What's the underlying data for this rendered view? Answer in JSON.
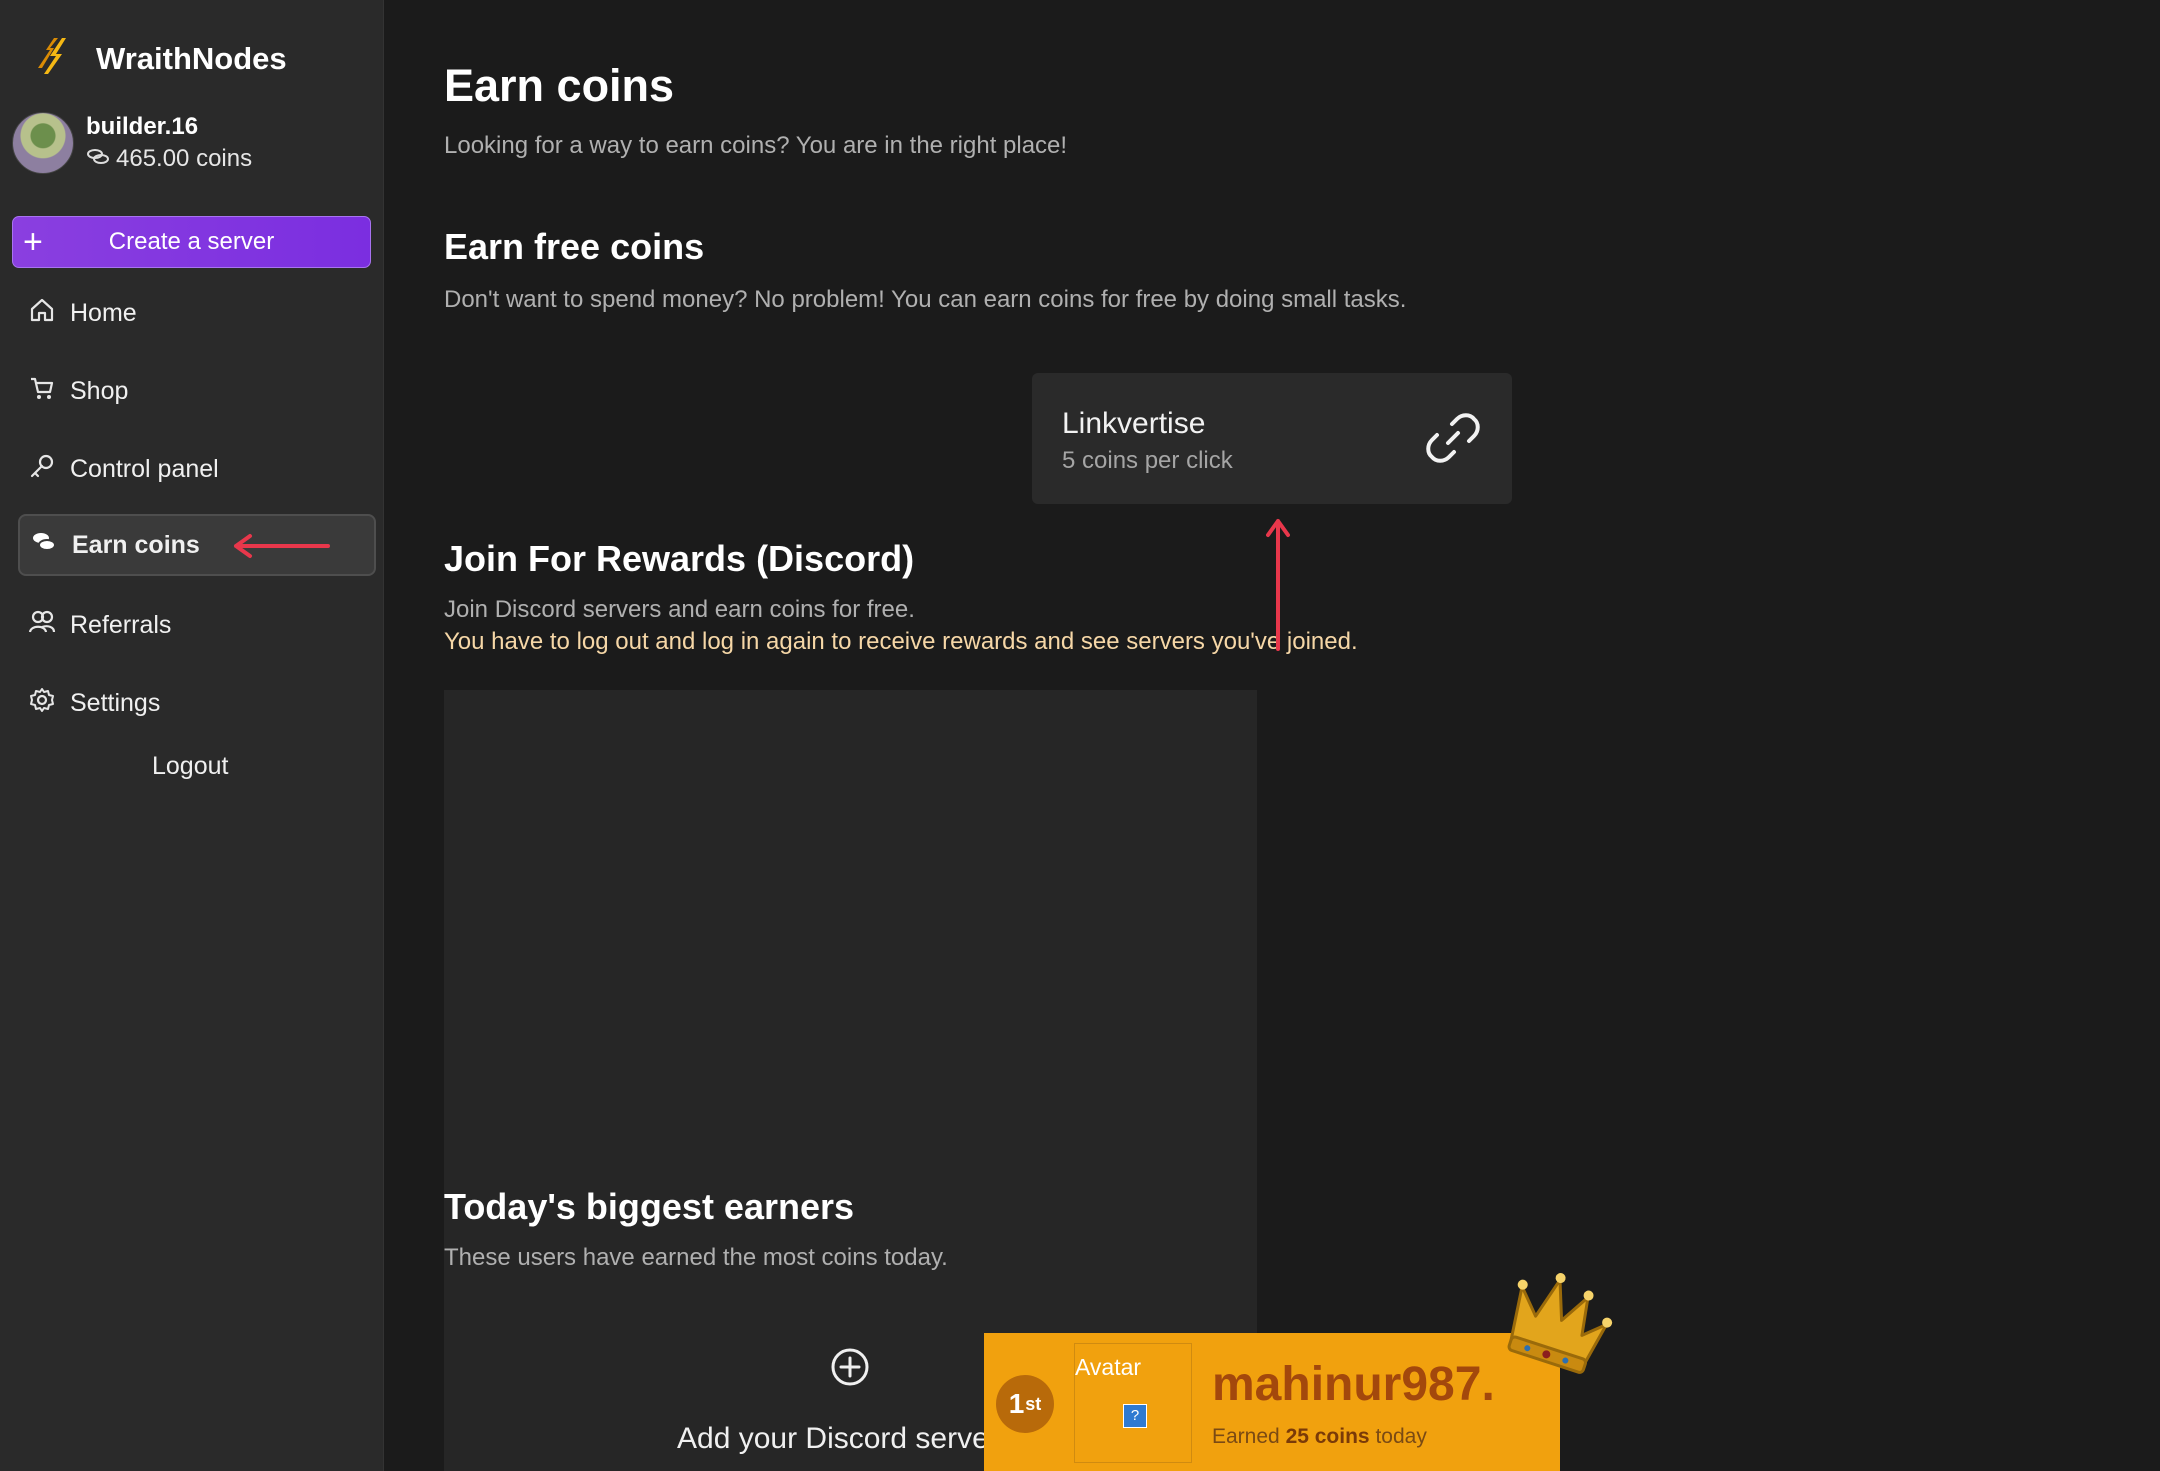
{
  "brand": {
    "name": "WraithNodes",
    "accent": "#f5b814"
  },
  "user": {
    "username": "builder.16",
    "coins": "465.00 coins"
  },
  "sidebar": {
    "create_label": "Create a server",
    "items": [
      {
        "label": "Home",
        "icon": "home-icon"
      },
      {
        "label": "Shop",
        "icon": "cart-icon"
      },
      {
        "label": "Control panel",
        "icon": "key-icon"
      },
      {
        "label": "Earn coins",
        "icon": "coins-icon",
        "active": true
      },
      {
        "label": "Referrals",
        "icon": "users-icon"
      },
      {
        "label": "Settings",
        "icon": "gear-icon"
      }
    ],
    "logout_label": "Logout"
  },
  "page": {
    "title": "Earn coins",
    "subtitle": "Looking for a way to earn coins? You are in the right place!",
    "free": {
      "title": "Earn free coins",
      "subtitle": "Don't want to spend money? No problem! You can earn coins for free by doing small tasks."
    },
    "linkvertise": {
      "title": "Linkvertise",
      "subtitle": "5 coins per click",
      "icon": "link-icon"
    },
    "discord": {
      "title": "Join For Rewards (Discord)",
      "subtitle": "Join Discord servers and earn coins for free.",
      "warning": "You have to log out and log in again to receive rewards and see servers you've joined.",
      "add_label": "Add your Discord server"
    },
    "earners": {
      "title": "Today's biggest earners",
      "subtitle": "These users have earned the most coins today."
    }
  },
  "winner": {
    "rank": "1",
    "rank_suffix": "st",
    "avatar_alt": "Avatar",
    "name": "mahinur987.",
    "earned_prefix": "Earned ",
    "earned_amount": "25 coins",
    "earned_suffix": " today"
  },
  "colors": {
    "highlight": "#e8374b",
    "create_button": "#8a3fe0",
    "warning": "#f6d7a7",
    "winner_bg": "#f1a10e"
  }
}
